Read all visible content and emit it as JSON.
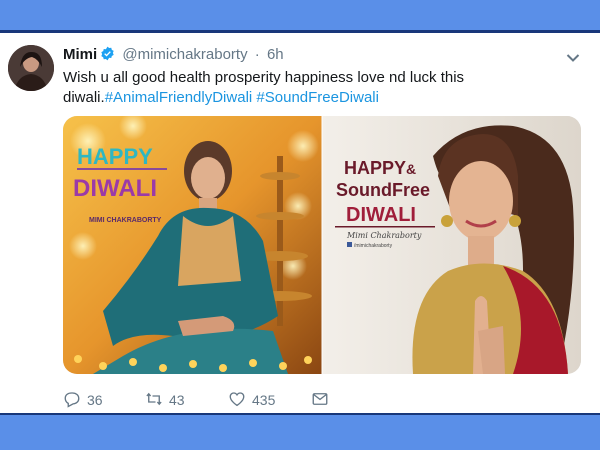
{
  "tweet": {
    "display_name": "Mimi",
    "handle": "@mimichakraborty",
    "separator": "·",
    "time": "6h",
    "text_plain": "Wish u all good health prosperity happiness love nd luck this diwali.",
    "hashtag_1": "#AnimalFriendlyDiwali",
    "hashtag_2": "#SoundFreeDiwali"
  },
  "media": {
    "left_image": {
      "line1": "HAPPY",
      "line2": "DIWALI",
      "credit": "MIMI CHAKRABORTY"
    },
    "right_image": {
      "line1": "HAPPY",
      "amp": "&",
      "line2": "SoundFree",
      "line3": "DIWALI",
      "signature": "Mimi Chakraborty",
      "social": "/mimichakraborty"
    }
  },
  "actions": {
    "replies": "36",
    "retweets": "43",
    "likes": "435"
  },
  "colors": {
    "hashtag": "#1b95e0",
    "verified": "#1da1f2",
    "frame": "#5a8fe8"
  },
  "icons": [
    "verified-badge-icon",
    "chevron-down-icon",
    "reply-icon",
    "retweet-icon",
    "like-icon",
    "message-icon"
  ]
}
